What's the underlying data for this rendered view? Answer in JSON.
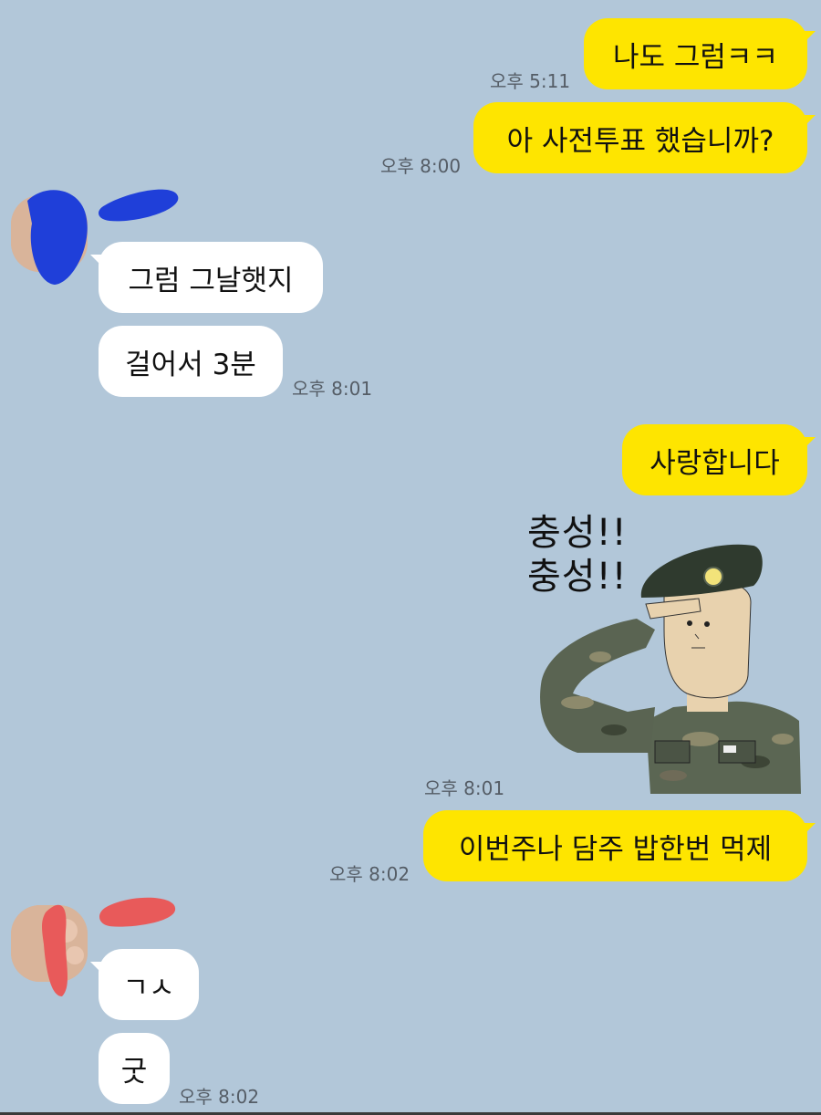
{
  "messages": {
    "m1": {
      "text": "나도 그럼ㅋㅋ",
      "time": "오후 5:11"
    },
    "m2": {
      "text": "아 사전투표 했습니까?",
      "time": "오후 8:00"
    },
    "m3": {
      "text": "그럼 그날햇지"
    },
    "m4": {
      "text": "걸어서 3분",
      "time": "오후 8:01"
    },
    "m5": {
      "text": "사랑합니다"
    },
    "sticker": {
      "line1": "충성!!",
      "line2": "충성!!",
      "time": "오후 8:01"
    },
    "m6": {
      "text": "이번주나 담주 밥한번 먹제",
      "time": "오후 8:02"
    },
    "m7": {
      "text": "ㄱㅅ"
    },
    "m8": {
      "text": "굿",
      "time": "오후 8:02"
    }
  },
  "colors": {
    "background": "#b2c7d9",
    "my_bubble": "#fee500",
    "their_bubble": "#ffffff",
    "redact_blue": "#1f3fd9",
    "redact_red": "#e85a5a"
  }
}
